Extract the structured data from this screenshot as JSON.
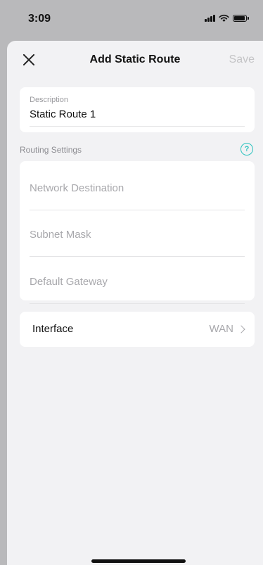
{
  "status_bar": {
    "time": "3:09",
    "icons": [
      "signal-icon",
      "wifi-icon",
      "battery-icon"
    ]
  },
  "nav": {
    "close_icon": "close-icon",
    "title": "Add Static Route",
    "save_label": "Save"
  },
  "description": {
    "label": "Description",
    "value": "Static Route 1"
  },
  "routing_settings": {
    "title": "Routing Settings",
    "help_icon": "help-icon",
    "fields": [
      {
        "placeholder": "Network Destination",
        "value": ""
      },
      {
        "placeholder": "Subnet Mask",
        "value": ""
      },
      {
        "placeholder": "Default Gateway",
        "value": ""
      }
    ]
  },
  "interface": {
    "label": "Interface",
    "value": "WAN",
    "icon": "chevron-right-icon"
  },
  "colors": {
    "accent": "#2dc3bf",
    "background": "#f2f2f4",
    "card": "#ffffff",
    "disabled_text": "#c4c4c6"
  }
}
